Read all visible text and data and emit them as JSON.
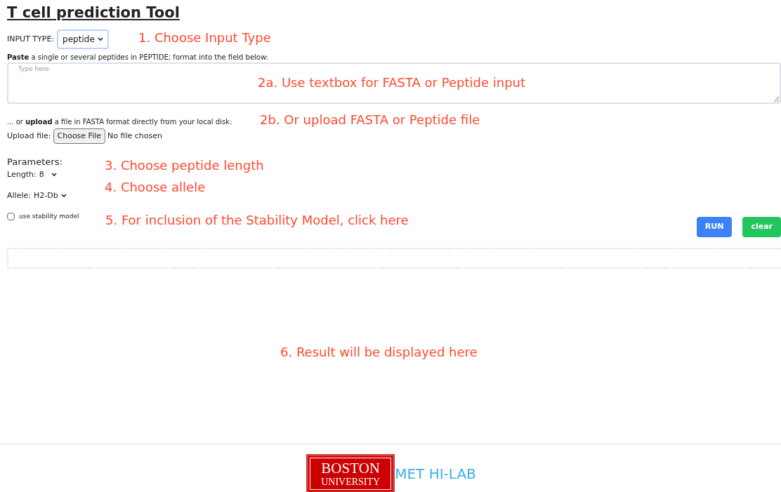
{
  "title": "T cell prediction Tool",
  "input_type": {
    "label": "INPUT TYPE:",
    "value": "peptide"
  },
  "paste_instruction": "**Paste** a single or several peptides in PEPTIDE; format into the field below:",
  "textarea": {
    "placeholder": "Type here"
  },
  "upload_instruction": "... or **upload** a file in FASTA format directly from your local disk:",
  "upload": {
    "label": "Upload file:",
    "button": "Choose File",
    "status": "No file chosen"
  },
  "parameters": {
    "heading": "Parameters:",
    "length": {
      "label": "Length:",
      "value": "8"
    },
    "allele": {
      "label": "Allele:",
      "value": "H2-Db"
    },
    "stability": {
      "label": "use stability model",
      "checked": false
    }
  },
  "buttons": [
    {
      "label": "RUN",
      "kind": "run"
    },
    {
      "label": "clear",
      "kind": "clear"
    }
  ],
  "annotations": [
    "1. Choose Input Type",
    "2a. Use textbox for FASTA or Peptide input",
    "2b. Or upload FASTA or Peptide file",
    "3. Choose peptide length",
    "4. Choose allele",
    "5. For inclusion of the Stability Model, click here",
    "6. Result will be displayed here"
  ],
  "footer": {
    "logo_line1": "BOSTON",
    "logo_line2": "UNIVERSITY",
    "lab": "MET HI-LAB"
  }
}
